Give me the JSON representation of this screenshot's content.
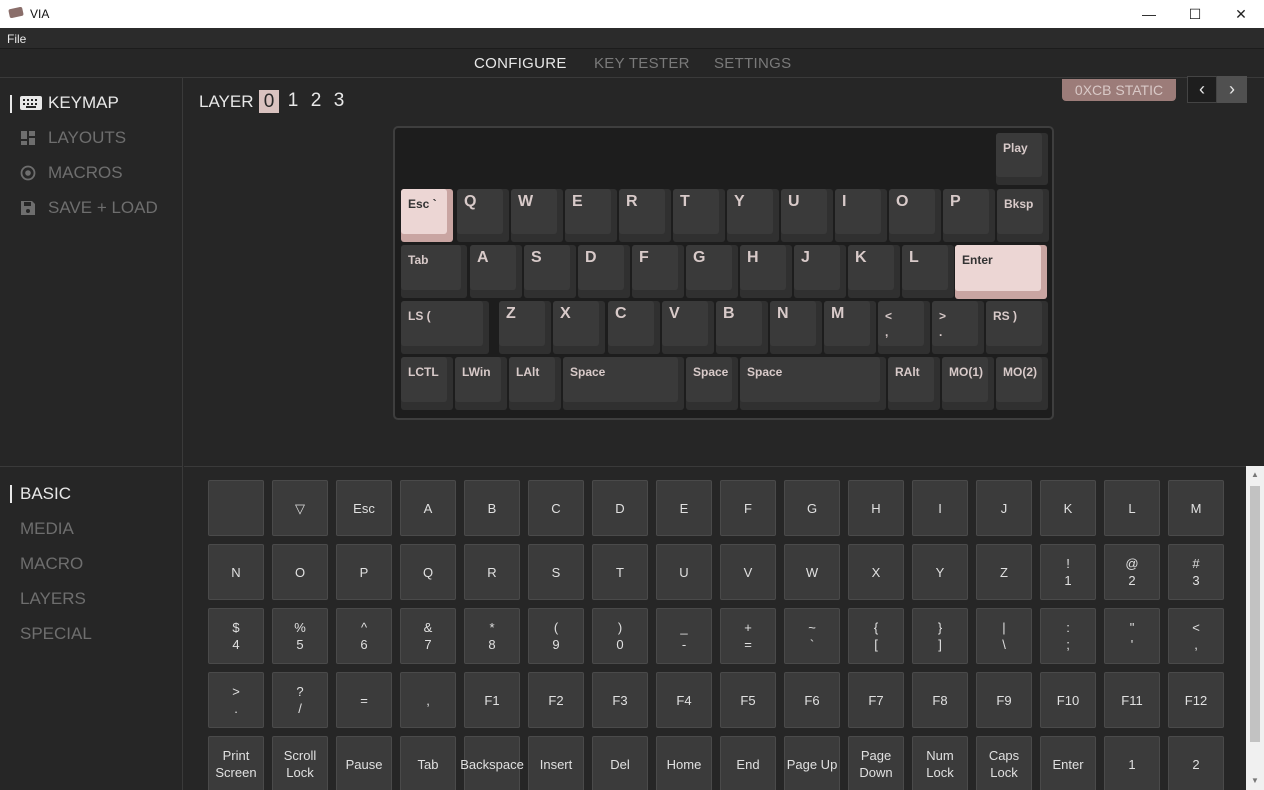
{
  "window": {
    "title": "VIA",
    "min": "—",
    "max": "☐",
    "close": "✕"
  },
  "menu": {
    "file": "File"
  },
  "nav": {
    "tabs": [
      {
        "label": "CONFIGURE"
      },
      {
        "label": "KEY TESTER"
      },
      {
        "label": "SETTINGS"
      }
    ],
    "active": "CONFIGURE"
  },
  "sidebar": {
    "items": [
      {
        "label": "KEYMAP"
      },
      {
        "label": "LAYOUTS"
      },
      {
        "label": "MACROS"
      },
      {
        "label": "SAVE + LOAD"
      }
    ],
    "active": "KEYMAP"
  },
  "layers": {
    "label": "LAYER",
    "numbers": [
      "0",
      "1",
      "2",
      "3"
    ],
    "selected": "0"
  },
  "lighting": {
    "badge": "0XCB STATIC",
    "prev": "‹",
    "next": "›"
  },
  "keyboard": {
    "keys": [
      {
        "label": "Play"
      },
      {
        "label": "Esc `"
      },
      {
        "label": "Q"
      },
      {
        "label": "W"
      },
      {
        "label": "E"
      },
      {
        "label": "R"
      },
      {
        "label": "T"
      },
      {
        "label": "Y"
      },
      {
        "label": "U"
      },
      {
        "label": "I"
      },
      {
        "label": "O"
      },
      {
        "label": "P"
      },
      {
        "label": "Bksp"
      },
      {
        "label": "Tab"
      },
      {
        "label": "A"
      },
      {
        "label": "S"
      },
      {
        "label": "D"
      },
      {
        "label": "F"
      },
      {
        "label": "G"
      },
      {
        "label": "H"
      },
      {
        "label": "J"
      },
      {
        "label": "K"
      },
      {
        "label": "L"
      },
      {
        "label": "Enter"
      },
      {
        "label": "LS ("
      },
      {
        "label": "Z"
      },
      {
        "label": "X"
      },
      {
        "label": "C"
      },
      {
        "label": "V"
      },
      {
        "label": "B"
      },
      {
        "label": "N"
      },
      {
        "label": "M"
      },
      {
        "label": "<",
        "label2": ","
      },
      {
        "label": ">",
        "label2": "."
      },
      {
        "label": "RS )"
      },
      {
        "label": "LCTL"
      },
      {
        "label": "LWin"
      },
      {
        "label": "LAlt"
      },
      {
        "label": "Space"
      },
      {
        "label": "Space"
      },
      {
        "label": "Space"
      },
      {
        "label": "RAlt"
      },
      {
        "label": "MO(1)"
      },
      {
        "label": "MO(2)"
      }
    ]
  },
  "categories": {
    "items": [
      {
        "label": "BASIC"
      },
      {
        "label": "MEDIA"
      },
      {
        "label": "MACRO"
      },
      {
        "label": "LAYERS"
      },
      {
        "label": "SPECIAL"
      }
    ],
    "active": "BASIC"
  },
  "keycodes": {
    "rows": [
      [
        {
          "l1": ""
        },
        {
          "l1": "▽"
        },
        {
          "l1": "Esc"
        },
        {
          "l1": "A"
        },
        {
          "l1": "B"
        },
        {
          "l1": "C"
        },
        {
          "l1": "D"
        },
        {
          "l1": "E"
        },
        {
          "l1": "F"
        },
        {
          "l1": "G"
        },
        {
          "l1": "H"
        },
        {
          "l1": "I"
        },
        {
          "l1": "J"
        },
        {
          "l1": "K"
        },
        {
          "l1": "L"
        },
        {
          "l1": "M"
        }
      ],
      [
        {
          "l1": "N"
        },
        {
          "l1": "O"
        },
        {
          "l1": "P"
        },
        {
          "l1": "Q"
        },
        {
          "l1": "R"
        },
        {
          "l1": "S"
        },
        {
          "l1": "T"
        },
        {
          "l1": "U"
        },
        {
          "l1": "V"
        },
        {
          "l1": "W"
        },
        {
          "l1": "X"
        },
        {
          "l1": "Y"
        },
        {
          "l1": "Z"
        },
        {
          "l1": "!",
          "l2": "1"
        },
        {
          "l1": "@",
          "l2": "2"
        },
        {
          "l1": "#",
          "l2": "3"
        }
      ],
      [
        {
          "l1": "$",
          "l2": "4"
        },
        {
          "l1": "%",
          "l2": "5"
        },
        {
          "l1": "^",
          "l2": "6"
        },
        {
          "l1": "&",
          "l2": "7"
        },
        {
          "l1": "*",
          "l2": "8"
        },
        {
          "l1": "(",
          "l2": "9"
        },
        {
          "l1": ")",
          "l2": "0"
        },
        {
          "l1": "_",
          "l2": "-"
        },
        {
          "l1": "+",
          "l2": "="
        },
        {
          "l1": "~",
          "l2": "`"
        },
        {
          "l1": "{",
          "l2": "["
        },
        {
          "l1": "}",
          "l2": "]"
        },
        {
          "l1": "|",
          "l2": "\\"
        },
        {
          "l1": ":",
          "l2": ";"
        },
        {
          "l1": "\"",
          "l2": "'"
        },
        {
          "l1": "<",
          "l2": ","
        }
      ],
      [
        {
          "l1": ">",
          "l2": "."
        },
        {
          "l1": "?",
          "l2": "/"
        },
        {
          "l1": "="
        },
        {
          "l1": ","
        },
        {
          "l1": "F1"
        },
        {
          "l1": "F2"
        },
        {
          "l1": "F3"
        },
        {
          "l1": "F4"
        },
        {
          "l1": "F5"
        },
        {
          "l1": "F6"
        },
        {
          "l1": "F7"
        },
        {
          "l1": "F8"
        },
        {
          "l1": "F9"
        },
        {
          "l1": "F10"
        },
        {
          "l1": "F11"
        },
        {
          "l1": "F12"
        }
      ],
      [
        {
          "l1": "Print",
          "l2": "Screen"
        },
        {
          "l1": "Scroll",
          "l2": "Lock"
        },
        {
          "l1": "Pause"
        },
        {
          "l1": "Tab"
        },
        {
          "l1": "Backspace"
        },
        {
          "l1": "Insert"
        },
        {
          "l1": "Del"
        },
        {
          "l1": "Home"
        },
        {
          "l1": "End"
        },
        {
          "l1": "Page Up"
        },
        {
          "l1": "Page",
          "l2": "Down"
        },
        {
          "l1": "Num",
          "l2": "Lock"
        },
        {
          "l1": "Caps",
          "l2": "Lock"
        },
        {
          "l1": "Enter"
        },
        {
          "l1": "1"
        },
        {
          "l1": "2"
        }
      ]
    ]
  },
  "colors": {
    "accent": "#ecd6d4",
    "accent_dark": "#c9a5a2",
    "background": "#262626",
    "key": "#3b3b3b"
  }
}
